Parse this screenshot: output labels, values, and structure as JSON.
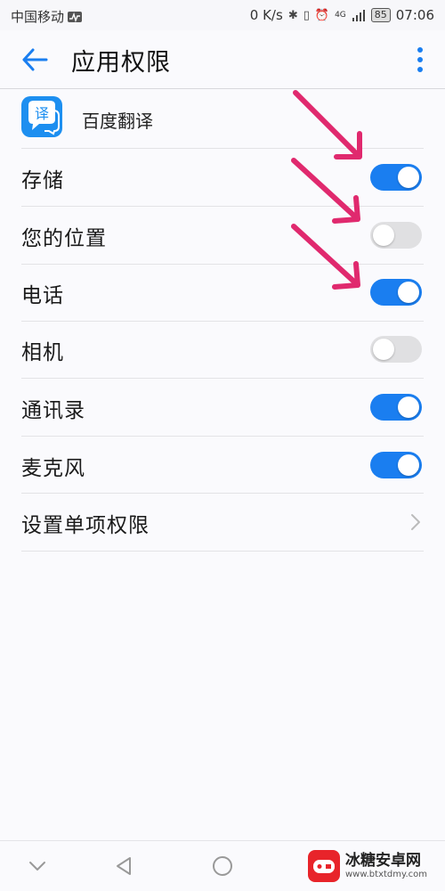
{
  "status_bar": {
    "carrier": "中国移动",
    "speed": "0 K/s",
    "network": "4G",
    "battery": "85",
    "time": "07:06"
  },
  "header": {
    "title": "应用权限",
    "back_icon": "arrow-left-icon",
    "more_icon": "more-vertical-icon"
  },
  "app": {
    "name": "百度翻译",
    "icon_glyph": "译",
    "icon_color": "#1d8ff0"
  },
  "permissions": [
    {
      "label": "存储",
      "enabled": true
    },
    {
      "label": "您的位置",
      "enabled": false
    },
    {
      "label": "电话",
      "enabled": true
    },
    {
      "label": "相机",
      "enabled": false
    },
    {
      "label": "通讯录",
      "enabled": true
    },
    {
      "label": "麦克风",
      "enabled": true
    }
  ],
  "settings_item": {
    "label": "设置单项权限"
  },
  "colors": {
    "accent": "#1a7ef0",
    "toggle_off": "#e0e0e2",
    "annotation_arrow": "#e0296e"
  },
  "watermark": {
    "title": "冰糖安卓网",
    "url": "www.btxtdmy.com"
  }
}
